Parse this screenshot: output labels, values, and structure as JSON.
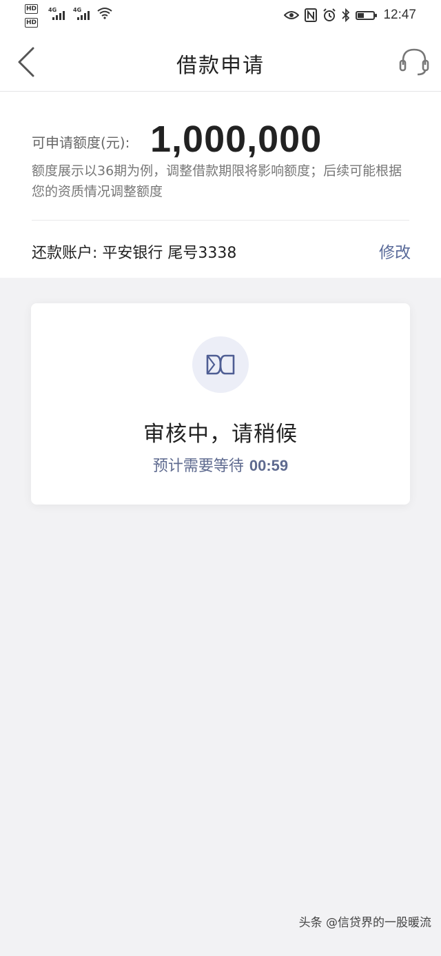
{
  "status_bar": {
    "hd1": "HD",
    "hd2": "HD",
    "sim1_label": "4G",
    "sim2_label": "4G",
    "time": "12:47",
    "icons": [
      "eye-icon",
      "nfc-icon",
      "alarm-icon",
      "bluetooth-icon",
      "battery-icon"
    ]
  },
  "nav": {
    "title": "借款申请",
    "back_icon": "chevron-left-icon",
    "service_icon": "headset-icon"
  },
  "limit": {
    "label": "可申请额度(元):",
    "value": "1,000,000",
    "note": "额度展示以36期为例，调整借款期限将影响额度；后续可能根据您的资质情况调整额度"
  },
  "account": {
    "label": "还款账户: 平安银行 尾号3338",
    "modify": "修改"
  },
  "review": {
    "logo_icon": "brand-logo-icon",
    "title": "审核中，请稍候",
    "wait_label": "预计需要等待",
    "countdown": "00:59"
  },
  "watermark": "头条 @信贷界的一股暖流",
  "colors": {
    "accent": "#5a6b9a",
    "background": "#f2f2f4",
    "card": "#ffffff"
  }
}
